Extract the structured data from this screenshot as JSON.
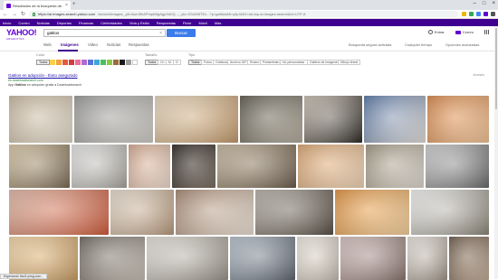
{
  "browser": {
    "tab_title": "Resultados de la búsqueda de ...",
    "address_host": "https://ar.images.search.yahoo.com",
    "address_rest": "/search/images;_ylt=AwrJ6hAPmpbBgAgpXd0Q...;_ylu=X3oDMTEz...?p=gatitos&fr=yfp-t&fr2=sb-top-ar.images.search&ei=UTF-8"
  },
  "yahoo_nav": [
    "Inicio",
    "Correo",
    "Noticias",
    "Deportes",
    "Finanzas",
    "Celebridades",
    "Vida y Estilo",
    "Respuestas",
    "Flickr",
    "Móvil",
    "Más"
  ],
  "header": {
    "logo": "YAHOO!",
    "logo_sub": "ARGENTINA",
    "search_value": "gatitos",
    "search_button": "Buscar",
    "signin": "Entrar",
    "mail": "Correo"
  },
  "tabs": {
    "items": [
      "Web",
      "Imágenes",
      "Video",
      "Noticias",
      "Respuestas"
    ],
    "active": "Imágenes",
    "safe_search": "Búsqueda segura activada",
    "any_time": "Cualquier tiempo",
    "advanced": "Opciones avanzadas"
  },
  "filters": {
    "color_label": "Color",
    "color_all": "Todos",
    "colors": [
      "#f6d14a",
      "#f1a13e",
      "#e45a3a",
      "#d33b3b",
      "#e96fa0",
      "#b06ad4",
      "#5a73d6",
      "#3ea6d8",
      "#4cbf5f",
      "#8bc84a",
      "#9b6b3d",
      "#1a1a1a",
      "#9e9e9e",
      "#ffffff"
    ],
    "size_label": "Tamaño",
    "sizes": [
      "Todos",
      "Ch",
      "M",
      "G"
    ],
    "type_label": "Tipo",
    "types": [
      "Todos",
      "Fotos",
      "Gráficos",
      "Archivo GIF",
      "Rostro",
      "Portaretrato",
      "No personalizar",
      "Galería de imágenes",
      "Dibujo lineal"
    ]
  },
  "ad": {
    "title": "Gatitos en adopción - Éxito asegurado",
    "url": "es.downloadsearch.com",
    "desc_prefix": "App",
    "desc_bold": "Gatitos",
    "desc_rest": "en adopción gratis a Downloadsearch",
    "label": "Anuncio"
  },
  "status_text": "Esperando ttsx3.yimg.com...",
  "thumbnails": [
    {
      "colors": [
        "#c9b9a2",
        "#e5dccb"
      ]
    },
    {
      "colors": [
        "#9a9a9a",
        "#d4d0c9"
      ]
    },
    {
      "colors": [
        "#e8d8bf",
        "#c59a6a"
      ]
    },
    {
      "colors": [
        "#5d5a4f",
        "#b8b0a0"
      ]
    },
    {
      "colors": [
        "#cbc2b4",
        "#2e2a26"
      ]
    },
    {
      "colors": [
        "#5876a6",
        "#e6e2dd"
      ]
    },
    {
      "colors": [
        "#d8874a",
        "#f3c79a"
      ]
    },
    {
      "colors": [
        "#d9c7a6",
        "#7a6a55"
      ]
    },
    {
      "colors": [
        "#e6e6e6",
        "#a8a49c"
      ]
    },
    {
      "colors": [
        "#d3a78d",
        "#f0ddd0"
      ]
    },
    {
      "colors": [
        "#2b2521",
        "#7b6e62"
      ]
    },
    {
      "colors": [
        "#c7b79e",
        "#6b5c4b"
      ]
    },
    {
      "colors": [
        "#d9a36f",
        "#f2d7b8"
      ]
    },
    {
      "colors": [
        "#9f947f",
        "#e0dbd2"
      ]
    },
    {
      "colors": [
        "#cfcfcf",
        "#6a6a6a"
      ]
    },
    {
      "colors": [
        "#e0b9a8",
        "#d25c3c"
      ]
    },
    {
      "colors": [
        "#e8ddd0",
        "#b7997b"
      ]
    },
    {
      "colors": [
        "#a58670",
        "#efe4d7"
      ]
    },
    {
      "colors": [
        "#b9b3aa",
        "#584f45"
      ]
    },
    {
      "colors": [
        "#e0913e",
        "#f7d4a1"
      ]
    },
    {
      "colors": [
        "#f4f4f4",
        "#8c8578"
      ]
    },
    {
      "colors": [
        "#f3d6a8",
        "#c99d64"
      ]
    },
    {
      "colors": [
        "#6f6860",
        "#c9c2b7"
      ]
    },
    {
      "colors": [
        "#e7e3dc",
        "#9a948a"
      ]
    },
    {
      "colors": [
        "#b8c2cc",
        "#5f6670"
      ]
    },
    {
      "colors": [
        "#efe9e1",
        "#c7bdb1"
      ]
    },
    {
      "colors": [
        "#d8c3c0",
        "#8a7670"
      ]
    },
    {
      "colors": [
        "#e9e4df",
        "#a09487"
      ]
    },
    {
      "colors": [
        "#6d5a4a",
        "#c3ad97"
      ]
    }
  ]
}
